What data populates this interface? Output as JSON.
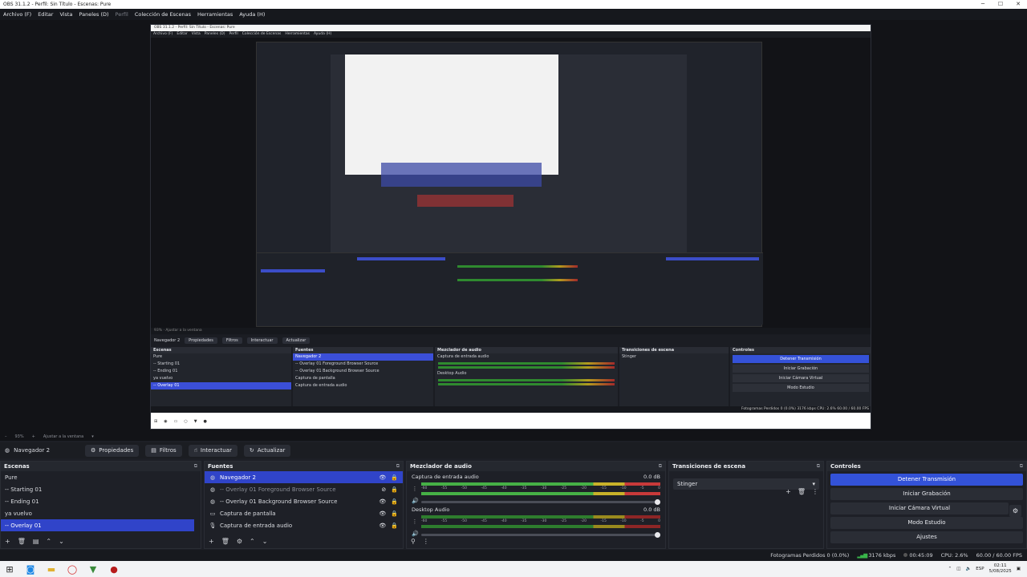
{
  "window": {
    "title": "OBS 31.1.2 - Perfil: Sin Título - Escenas: Pure",
    "minimize": "─",
    "maximize": "☐",
    "close": "✕"
  },
  "menu": [
    "Archivo (F)",
    "Editar",
    "Vista",
    "Paneles (D)",
    "Perfil",
    "Colección de Escenas",
    "Herramientas",
    "Ayuda (H)"
  ],
  "zoom": {
    "value": "93%",
    "fit": "Ajustar a la ventana"
  },
  "toolbar": {
    "source": "Navegador 2",
    "properties": "Propiedades",
    "filters": "Filtros",
    "interact": "Interactuar",
    "refresh": "Actualizar"
  },
  "scenes": {
    "title": "Escenas",
    "items": [
      "Pure",
      "-- Starting 01",
      "-- Ending 01",
      "ya vuelvo",
      "-- Overlay 01"
    ],
    "selected_index": 4
  },
  "sources": {
    "title": "Fuentes",
    "items": [
      {
        "label": "Navegador 2",
        "icon": "globe-icon"
      },
      {
        "label": "-- Overlay 01  Foreground Browser Source",
        "icon": "globe-icon"
      },
      {
        "label": "-- Overlay 01  Background Browser Source",
        "icon": "globe-icon"
      },
      {
        "label": "Captura de pantalla",
        "icon": "monitor-icon"
      },
      {
        "label": "Captura de entrada audio",
        "icon": "microphone-icon"
      }
    ]
  },
  "mixer": {
    "title": "Mezclador de audio",
    "channels": [
      {
        "name": "Captura de entrada audio",
        "db": "0.0 dB"
      },
      {
        "name": "Desktop Audio",
        "db": "0.0 dB"
      }
    ],
    "ticks": [
      "-60",
      "-55",
      "-50",
      "-45",
      "-40",
      "-35",
      "-30",
      "-25",
      "-20",
      "-15",
      "-10",
      "-5",
      "0"
    ]
  },
  "transitions": {
    "title": "Transiciones de escena",
    "selected": "Stinger"
  },
  "controls": {
    "title": "Controles",
    "stop_stream": "Detener Transmisión",
    "start_record": "Iniciar Grabación",
    "start_vcam": "Iniciar Cámara Virtual",
    "studio_mode": "Modo Estudio",
    "settings": "Ajustes"
  },
  "status": {
    "dropped": "Fotogramas Perdidos 0 (0.0%)",
    "bitrate": "3176 kbps",
    "time": "00:45:09",
    "cpu": "CPU: 2.6%",
    "fps": "60.00 / 60.00 FPS"
  },
  "taskbar": {
    "lang": "ESP",
    "time": "02:11",
    "date": "5/08/2025"
  },
  "colors": {
    "accent": "#3352d8",
    "selection": "#3044c9",
    "background": "#1d1f26"
  }
}
